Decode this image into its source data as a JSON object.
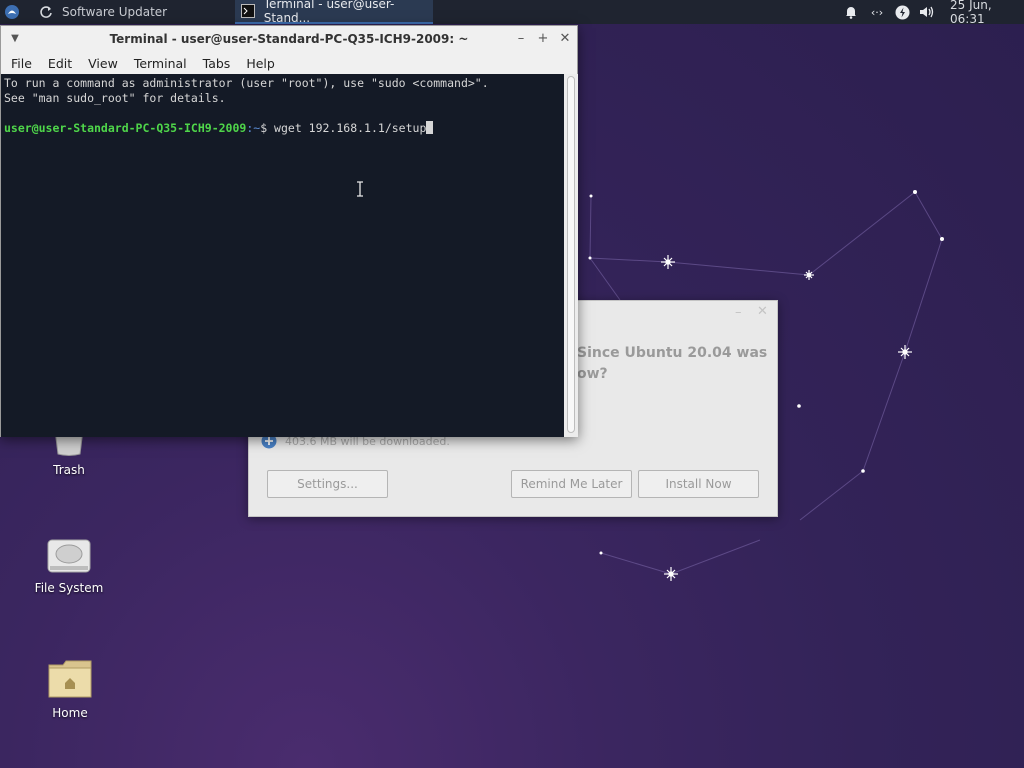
{
  "panel": {
    "app_menu_icon": "xubuntu-logo-icon",
    "tasks": [
      {
        "label": "Software Updater",
        "icon": "refresh-icon"
      },
      {
        "label": "Terminal - user@user-Stand...",
        "icon": "terminal-icon"
      }
    ],
    "tray_icons": [
      "bell-icon",
      "network-icon",
      "power-icon",
      "volume-icon"
    ],
    "clock": "25 Jun, 06:31"
  },
  "desktop": {
    "icons": [
      {
        "label": "Trash",
        "icon": "trash-icon"
      },
      {
        "label": "File System",
        "icon": "drive-icon"
      },
      {
        "label": "Home",
        "icon": "home-folder-icon"
      }
    ]
  },
  "updater": {
    "question_line1": "Since Ubuntu 20.04 was",
    "question_line2": "ow?",
    "download_text": "403.6 MB will be downloaded.",
    "settings_label": "Settings...",
    "remind_label": "Remind Me Later",
    "install_label": "Install Now"
  },
  "terminal": {
    "title": "Terminal - user@user-Standard-PC-Q35-ICH9-2009: ~",
    "menu": [
      "File",
      "Edit",
      "View",
      "Terminal",
      "Tabs",
      "Help"
    ],
    "line1": "To run a command as administrator (user \"root\"), use \"sudo <command>\".",
    "line2": "See \"man sudo_root\" for details.",
    "prompt_user": "user@user-Standard-PC-Q35-ICH9-2009",
    "prompt_path": ":~",
    "prompt_sym": "$ ",
    "command": "wget 192.168.1.1/setup"
  }
}
